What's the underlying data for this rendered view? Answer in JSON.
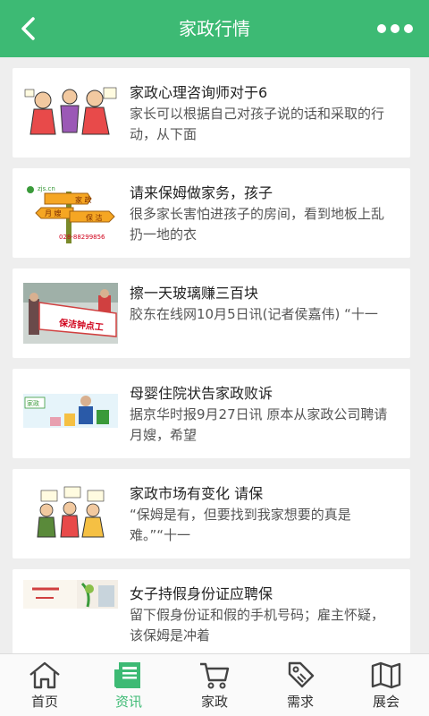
{
  "header": {
    "title": "家政行情",
    "back_icon": "back-arrow-icon",
    "more_icon": "more-dots-icon"
  },
  "articles": [
    {
      "title": "家政心理咨询师对于6",
      "summary": "家长可以根据自己对孩子说的话和采取的行动，从下面"
    },
    {
      "title": "请来保姆做家务，孩子",
      "summary": "很多家长害怕进孩子的房间，看到地板上乱扔一地的衣"
    },
    {
      "title": "擦一天玻璃赚三百块",
      "summary": "胶东在线网10月5日讯(记者侯嘉伟) “十一"
    },
    {
      "title": "母婴住院状告家政败诉",
      "summary": "据京华时报9月27日讯 原本从家政公司聘请月嫂，希望"
    },
    {
      "title": "家政市场有变化 请保",
      "summary": "“保姆是有，但要找到我家想要的真是难。”“十一"
    },
    {
      "title": "女子持假身份证应聘保",
      "summary": "留下假身份证和假的手机号码；雇主怀疑，该保姆是冲着"
    }
  ],
  "thumbs": {
    "t2_site": "zjs.cn",
    "t2_sign1": "家 政",
    "t2_sign2": "月 嫂",
    "t2_sign3": "保 洁",
    "t2_phone": "028-88299856",
    "t3_banner": "保洁钟点工",
    "t4_logo": "家政"
  },
  "tabbar": {
    "active_color": "#3dba74",
    "items": [
      {
        "label": "首页",
        "icon": "home-icon"
      },
      {
        "label": "资讯",
        "icon": "news-icon",
        "active": true
      },
      {
        "label": "家政",
        "icon": "cart-icon"
      },
      {
        "label": "需求",
        "icon": "tag-icon"
      },
      {
        "label": "展会",
        "icon": "map-icon"
      }
    ]
  }
}
